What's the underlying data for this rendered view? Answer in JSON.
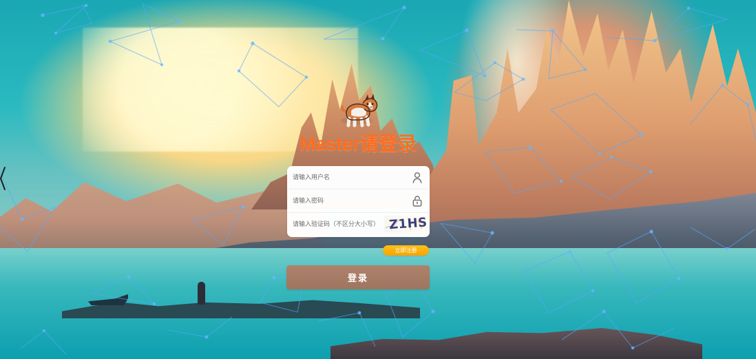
{
  "page": {
    "title": "Master请登录"
  },
  "form": {
    "username_placeholder": "请输入用户名",
    "password_placeholder": "请输入密码",
    "captcha_placeholder": "请输入验证码（不区分大小写）",
    "captcha_text": "Z1HS"
  },
  "actions": {
    "register_label": "立即注册",
    "login_label": "登录"
  },
  "icons": {
    "mascot": "corgi-icon",
    "username": "user-icon",
    "password": "lock-icon",
    "navigation": "chevron-left-icon"
  },
  "colors": {
    "title": "#ff6d1f",
    "register_button": "#f6a300",
    "login_button": "#a67a64",
    "network_lines": "#55a8ff"
  }
}
